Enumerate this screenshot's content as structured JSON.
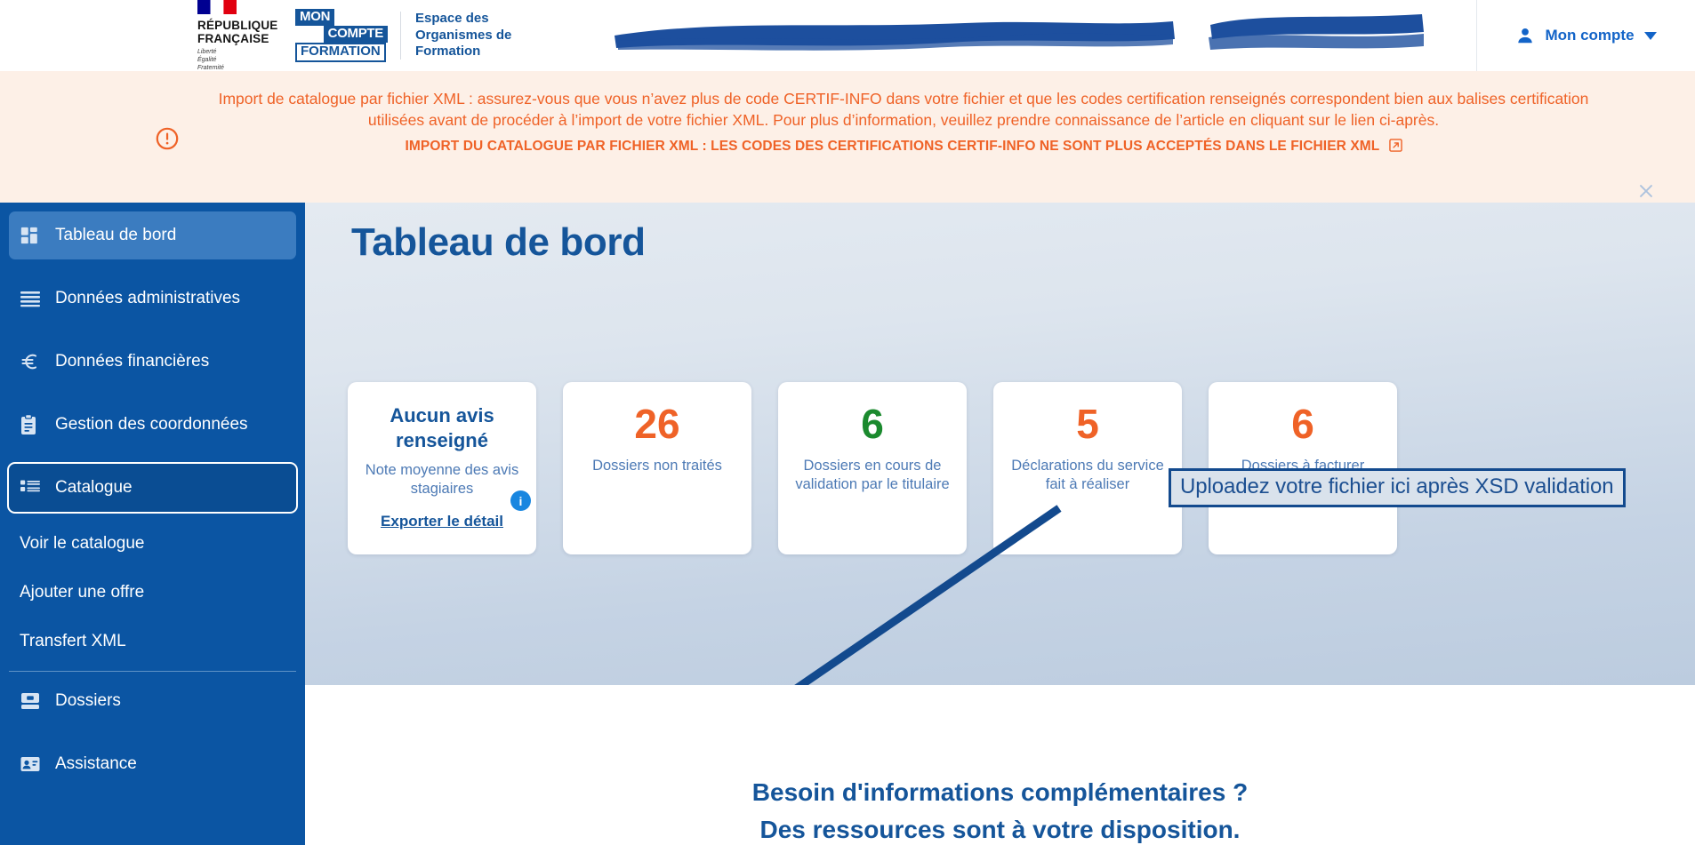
{
  "header": {
    "republic": {
      "line1": "RÉPUBLIQUE",
      "line2": "FRANÇAISE",
      "motto1": "Liberté",
      "motto2": "Égalité",
      "motto3": "Fraternité"
    },
    "logo": {
      "word1": "MON",
      "word2": "COMPTE",
      "word3": "FORMATION"
    },
    "title": "Espace des Organismes de Formation",
    "title_l1": "Espace des",
    "title_l2": "Organismes de",
    "title_l3": "Formation",
    "redacted_1": "[redacted]",
    "redacted_2": "[redacted]",
    "account_label": "Mon compte",
    "account_icon": "user-icon",
    "caret_icon": "chevron-down-icon"
  },
  "banner": {
    "icon": "alert-circle-icon",
    "message": "Import de catalogue par fichier XML : assurez-vous que vous n’avez plus de code CERTIF-INFO dans votre fichier et que les codes certification renseignés correspondent bien aux balises certification utilisées avant de procéder à l’import de votre fichier XML. Pour plus d’information, veuillez prendre connaissance de l’article en cliquant sur le lien ci-après.",
    "link_text": "IMPORT DU CATALOGUE PAR FICHIER XML : LES CODES DES CERTIFICATIONS CERTIF-INFO NE SONT PLUS ACCEPTÉS DANS LE FICHIER XML",
    "link_icon": "external-link-icon",
    "close_icon": "close-icon",
    "text_color": "#ef6227",
    "background": "#fdf0e7"
  },
  "sidebar": {
    "background": "#0b55a3",
    "items": [
      {
        "label": "Tableau de bord",
        "icon": "dashboard-icon",
        "state": "active"
      },
      {
        "label": "Données administratives",
        "icon": "list-lines-icon",
        "state": "default"
      },
      {
        "label": "Données financières",
        "icon": "euro-icon",
        "state": "default"
      },
      {
        "label": "Gestion des coordonnées",
        "icon": "clipboard-icon",
        "state": "default"
      },
      {
        "label": "Catalogue",
        "icon": "catalog-list-icon",
        "state": "focused"
      }
    ],
    "sub_items": [
      {
        "label": "Voir le catalogue"
      },
      {
        "label": "Ajouter une offre"
      },
      {
        "label": "Transfert XML"
      }
    ],
    "bottom_items": [
      {
        "label": "Dossiers",
        "icon": "inbox-icon"
      },
      {
        "label": "Assistance",
        "icon": "contact-card-icon"
      }
    ]
  },
  "main": {
    "page_title": "Tableau de bord",
    "cards": [
      {
        "type": "text",
        "heading": "Aucun avis renseigné",
        "sub": "Note moyenne des avis stagiaires",
        "link": "Exporter le détail",
        "badge": "i",
        "badge_icon": "info-icon"
      },
      {
        "type": "stat",
        "value": "26",
        "label": "Dossiers non traités",
        "color": "#ef6227"
      },
      {
        "type": "stat",
        "value": "6",
        "label": "Dossiers en cours de validation par le titulaire",
        "color": "#1b8a2e"
      },
      {
        "type": "stat",
        "value": "5",
        "label": "Déclarations du service fait à réaliser",
        "color": "#ef6227"
      },
      {
        "type": "stat",
        "value": "6",
        "label": "Dossiers à facturer",
        "color": "#ef6227"
      }
    ],
    "annotation": {
      "text": "Uploadez votre fichier ici après XSD validation",
      "border_color": "#134a8e",
      "arrow_color": "#134a8e"
    },
    "footer_line1": "Besoin d'informations complémentaires ?",
    "footer_line2": "Des ressources sont à votre disposition."
  }
}
